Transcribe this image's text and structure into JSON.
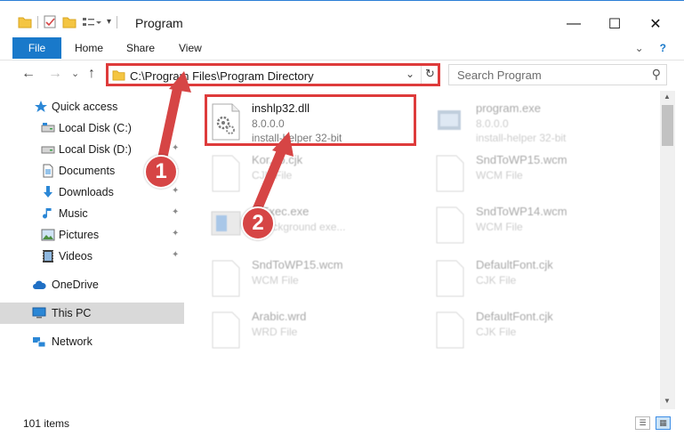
{
  "window": {
    "title": "Program",
    "minimize_glyph": "—",
    "maximize_glyph": "☐",
    "close_glyph": "✕"
  },
  "ribbon": {
    "tabs": [
      "File",
      "Home",
      "Share",
      "View"
    ],
    "collapse_glyph": "⌄",
    "help_glyph": "?"
  },
  "nav": {
    "back_glyph": "←",
    "forward_glyph": "→",
    "recent_glyph": "⌄",
    "up_glyph": "↑",
    "address": "C:\\Program Files\\Program Directory",
    "address_dropdown_glyph": "⌄",
    "refresh_glyph": "↻",
    "search_placeholder": "Search Program",
    "search_glyph": "⚲"
  },
  "sidebar": {
    "items": [
      {
        "label": "Quick access",
        "icon": "star-icon",
        "pinned": false
      },
      {
        "label": "Local Disk (C:)",
        "icon": "drive-icon",
        "pinned": false
      },
      {
        "label": "Local Disk (D:)",
        "icon": "drive-icon",
        "pinned": true
      },
      {
        "label": "Documents",
        "icon": "document-icon",
        "pinned": true
      },
      {
        "label": "Downloads",
        "icon": "download-icon",
        "pinned": true
      },
      {
        "label": "Music",
        "icon": "music-icon",
        "pinned": true
      },
      {
        "label": "Pictures",
        "icon": "pictures-icon",
        "pinned": true
      },
      {
        "label": "Videos",
        "icon": "video-icon",
        "pinned": true
      },
      {
        "label": "OneDrive",
        "icon": "cloud-icon",
        "pinned": false
      },
      {
        "label": "This PC",
        "icon": "computer-icon",
        "pinned": false,
        "selected": true
      },
      {
        "label": "Network",
        "icon": "network-icon",
        "pinned": false
      }
    ],
    "pin_glyph": "📌"
  },
  "files": [
    {
      "name": "inshlp32.dll",
      "version": "8.0.0.0",
      "desc": "install-helper 32-bit",
      "icon": "dll-gear-icon",
      "highlighted": true
    },
    {
      "name": "program.exe",
      "version": "8.0.0.0",
      "desc": "install-helper 32-bit",
      "icon": "exe-icon"
    },
    {
      "name": "Kor...o.cjk",
      "version": "",
      "desc": "CJK File",
      "icon": "blank-file-icon"
    },
    {
      "name": "SndToWP15.wcm",
      "version": "",
      "desc": "WCM File",
      "icon": "blank-file-icon"
    },
    {
      "name": "...Exec.exe",
      "version": "",
      "desc": "...background exe...",
      "icon": "app-exe-icon"
    },
    {
      "name": "SndToWP14.wcm",
      "version": "",
      "desc": "WCM File",
      "icon": "blank-file-icon"
    },
    {
      "name": "SndToWP15.wcm",
      "version": "",
      "desc": "WCM File",
      "icon": "blank-file-icon"
    },
    {
      "name": "DefaultFont.cjk",
      "version": "",
      "desc": "CJK File",
      "icon": "blank-file-icon"
    },
    {
      "name": "Arabic.wrd",
      "version": "",
      "desc": "WRD File",
      "icon": "blank-file-icon"
    },
    {
      "name": "DefaultFont.cjk",
      "version": "",
      "desc": "CJK File",
      "icon": "blank-file-icon"
    }
  ],
  "status": {
    "item_count": "101 items"
  },
  "markers": {
    "step1": "1",
    "step2": "2"
  },
  "colors": {
    "accent": "#1979ca",
    "marker": "#d64545",
    "highlight": "#de3b3b"
  }
}
